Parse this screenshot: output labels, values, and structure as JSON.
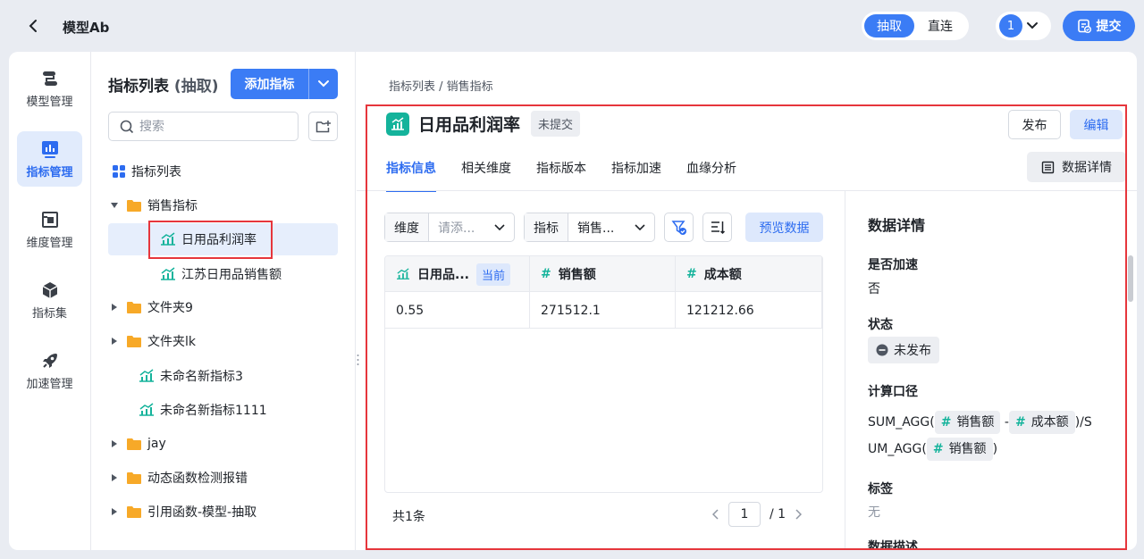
{
  "header": {
    "app_title": "模型Ab",
    "mode_active": "抽取",
    "mode_other": "直连",
    "user_badge": "1",
    "submit_label": "提交"
  },
  "nav": {
    "items": [
      {
        "label": "模型管理",
        "icon": "model-icon"
      },
      {
        "label": "指标管理",
        "icon": "metric-chart-icon",
        "active": true
      },
      {
        "label": "维度管理",
        "icon": "dimension-icon"
      },
      {
        "label": "指标集",
        "icon": "cube-icon"
      },
      {
        "label": "加速管理",
        "icon": "rocket-icon"
      }
    ]
  },
  "tree": {
    "title": "指标列表",
    "title_sub": "(抽取)",
    "add_label": "添加指标",
    "search_placeholder": "搜索",
    "items": [
      {
        "label": "指标列表",
        "type": "list"
      },
      {
        "label": "销售指标",
        "type": "folder",
        "expanded": true
      },
      {
        "label": "日用品利润率",
        "type": "metric",
        "selected": true
      },
      {
        "label": "江苏日用品销售额",
        "type": "metric"
      },
      {
        "label": "文件夹9",
        "type": "folder"
      },
      {
        "label": "文件夹lk",
        "type": "folder"
      },
      {
        "label": "未命名新指标3",
        "type": "metric"
      },
      {
        "label": "未命名新指标1111",
        "type": "metric"
      },
      {
        "label": "jay",
        "type": "folder"
      },
      {
        "label": "动态函数检测报错",
        "type": "folder"
      },
      {
        "label": "引用函数-模型-抽取",
        "type": "folder"
      }
    ]
  },
  "content": {
    "breadcrumb": "指标列表 / 销售指标",
    "metric_name": "日用品利润率",
    "status_badge": "未提交",
    "publish_label": "发布",
    "edit_label": "编辑",
    "tabs": [
      "指标信息",
      "相关维度",
      "指标版本",
      "指标加速",
      "血缘分析"
    ],
    "data_details_button": "数据详情",
    "filter": {
      "dim_label": "维度",
      "dim_placeholder": "请添...",
      "metric_label": "指标",
      "metric_value": "销售...",
      "preview_label": "预览数据"
    },
    "table": {
      "columns": [
        {
          "label": "日用品...",
          "tag": "当前"
        },
        {
          "label": "销售额"
        },
        {
          "label": "成本额"
        }
      ],
      "rows": [
        [
          "0.55",
          "271512.1",
          "121212.66"
        ]
      ],
      "total": "共1条",
      "page": "1",
      "page_total": "/ 1"
    }
  },
  "details": {
    "title": "数据详情",
    "accel_label": "是否加速",
    "accel_value": "否",
    "status_label": "状态",
    "status_value": "未发布",
    "formula_label": "计算口径",
    "formula_fn1": "SUM_AGG(",
    "formula_field1": "销售额",
    "formula_minus": "-",
    "formula_field2": "成本额",
    "formula_mid": ")/S",
    "formula_fn2": "UM_AGG(",
    "formula_field3": "销售额",
    "formula_end": ")",
    "tags_label": "标签",
    "tags_value": "无",
    "desc_label": "数据描述"
  }
}
